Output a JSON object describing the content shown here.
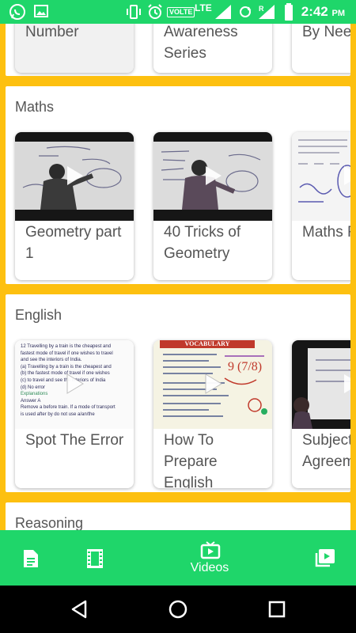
{
  "status_bar": {
    "volte": "VOLTE",
    "network": "LTE",
    "roaming": "R",
    "time": "2:42",
    "ampm": "PM"
  },
  "sections": {
    "top": {
      "cards": [
        "Missing Number",
        "General Awareness Series",
        "English Lecture By Nee"
      ]
    },
    "maths": {
      "title": "Maths",
      "cards": [
        {
          "title": "Geometry part 1"
        },
        {
          "title": "40 Tricks of Geometry"
        },
        {
          "title": "Maths For SS"
        }
      ]
    },
    "english": {
      "title": "English",
      "cards": [
        {
          "title": "Spot The Error"
        },
        {
          "title": "How To Prepare English"
        },
        {
          "title": "Subject Agreem"
        }
      ],
      "thumb_text": {
        "line1": "12 Travelling by a train is the cheapest and",
        "line2": "fastest mode of travel if one wishes to travel",
        "line3": "and see the interiors of India.",
        "line4": "(a) Travelling by a train is the cheapest and",
        "line5": "(b) the fastest mode of travel if one wishes",
        "line6": "(c) to travel and see the interiors of India",
        "line7": "(d) No error",
        "explanation": "Explanations",
        "answer": "Answer A",
        "line8": "Remove a before train. If a mode of transport",
        "line9": "is used after by do not use a/an/the",
        "vocab": "VOCABULARY"
      }
    },
    "reasoning": {
      "title": "Reasoning"
    }
  },
  "bottom_nav": {
    "active_label": "Videos"
  },
  "colors": {
    "green": "#1fd66a",
    "yellow": "#fdc010",
    "text": "#555555"
  }
}
